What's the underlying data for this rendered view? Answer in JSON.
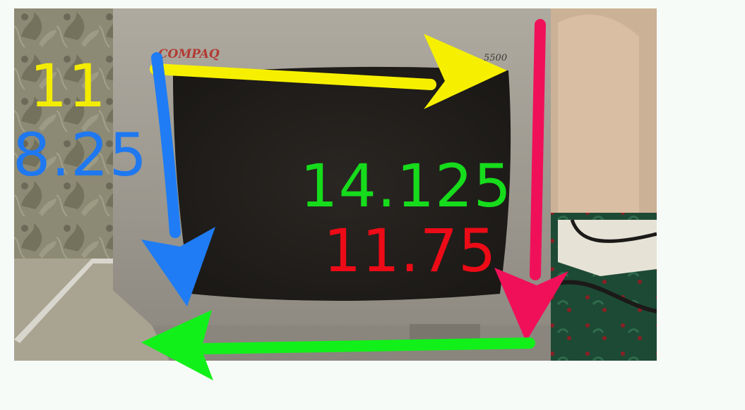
{
  "photo": {
    "brand_text": "COMPAQ",
    "model_text": "5500"
  },
  "measurements": [
    {
      "id": "yellow",
      "value": "11",
      "color": "#f3ec00"
    },
    {
      "id": "blue",
      "value": "8.25",
      "color": "#1f78f0"
    },
    {
      "id": "green",
      "value": "14.125",
      "color": "#16dc1c"
    },
    {
      "id": "red",
      "value": "11.75",
      "color": "#ec0b16"
    }
  ],
  "arrow_colors": {
    "horizontal_top": "#f6f000",
    "vertical_left": "#1f7cf4",
    "vertical_right": "#f0105a",
    "horizontal_bottom": "#12f01a"
  }
}
